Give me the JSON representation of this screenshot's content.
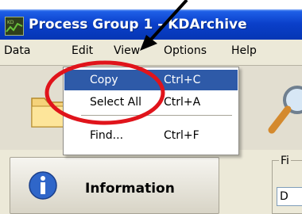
{
  "window": {
    "title": "Process Group 1 - KDArchive"
  },
  "menubar": {
    "items": [
      "Data",
      "Edit",
      "View",
      "Options",
      "Help"
    ]
  },
  "edit_menu": {
    "items": [
      {
        "label": "Copy",
        "shortcut": "Ctrl+C",
        "highlighted": true
      },
      {
        "label": "Select All",
        "shortcut": "Ctrl+A",
        "highlighted": false
      },
      {
        "label": "Find...",
        "shortcut": "Ctrl+F",
        "highlighted": false
      }
    ]
  },
  "main": {
    "info_panel": {
      "label": "Information",
      "icon": "info-icon"
    },
    "group": {
      "label": "Fi",
      "field_value": "D"
    }
  },
  "annotation": {
    "circle_color": "#e0141b",
    "arrow_color": "#000000"
  },
  "colors": {
    "titlebar": "#0a3fc9",
    "menu_highlight": "#2e5aa8",
    "menubar": "#ece9d8"
  }
}
